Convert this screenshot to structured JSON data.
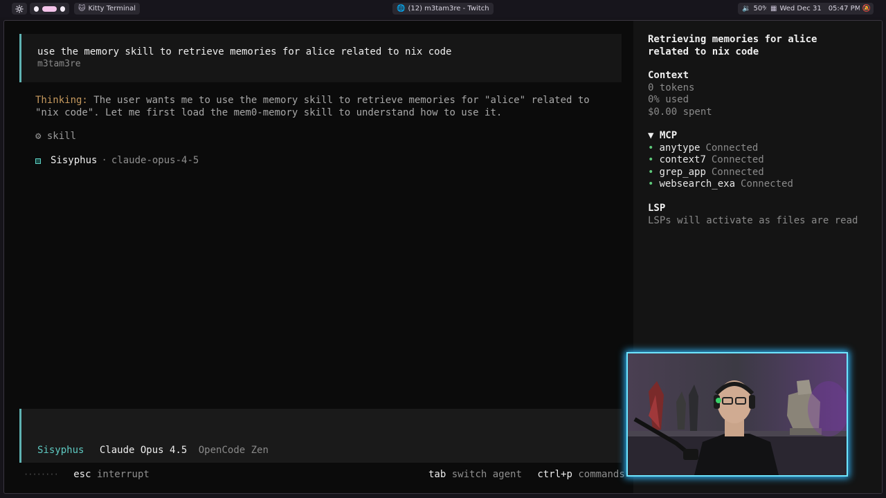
{
  "topbar": {
    "app_label": "Kitty Terminal",
    "window_title": "(12) m3tam3re - Twitch",
    "volume": "50%",
    "date": "Wed Dec 31",
    "time": "05:47 PM"
  },
  "conversation": {
    "user_message": "use the memory skill to retrieve memories for alice related to nix code",
    "user_name": "m3tam3re",
    "thinking_label": "Thinking:",
    "thinking_text": "The user wants me to use the memory skill to retrieve memories for \"alice\" related to \"nix code\". Let me first load the mem0-memory skill to understand how to use it.",
    "tool_icon": "⚙",
    "tool_label": "skill",
    "agent_name": "Sisyphus",
    "agent_separator": "·",
    "agent_model": "claude-opus-4-5"
  },
  "input": {
    "agent": "Sisyphus",
    "model": "Claude Opus 4.5",
    "provider": "OpenCode Zen"
  },
  "footer": {
    "spinner": "········",
    "left_key": "esc",
    "left_desc": "interrupt",
    "right_key1": "tab",
    "right_desc1": "switch agent",
    "right_key2": "ctrl+p",
    "right_desc2": "commands"
  },
  "sidebar": {
    "title_line1": "Retrieving memories for alice",
    "title_line2": "related to nix code",
    "context_heading": "Context",
    "tokens": "0 tokens",
    "used": "0% used",
    "spent": "$0.00 spent",
    "mcp_heading": "▼ MCP",
    "mcp_servers": [
      {
        "name": "anytype",
        "status": "Connected"
      },
      {
        "name": "context7",
        "status": "Connected"
      },
      {
        "name": "grep_app",
        "status": "Connected"
      },
      {
        "name": "websearch_exa",
        "status": "Connected"
      }
    ],
    "lsp_heading": "LSP",
    "lsp_note": "LSPs will activate as files are read"
  },
  "colors": {
    "accent_teal": "#5fb3b3",
    "thinking_label": "#c79a5e",
    "mcp_bullet": "#5ec97a",
    "cam_border": "#6fe6ff"
  }
}
